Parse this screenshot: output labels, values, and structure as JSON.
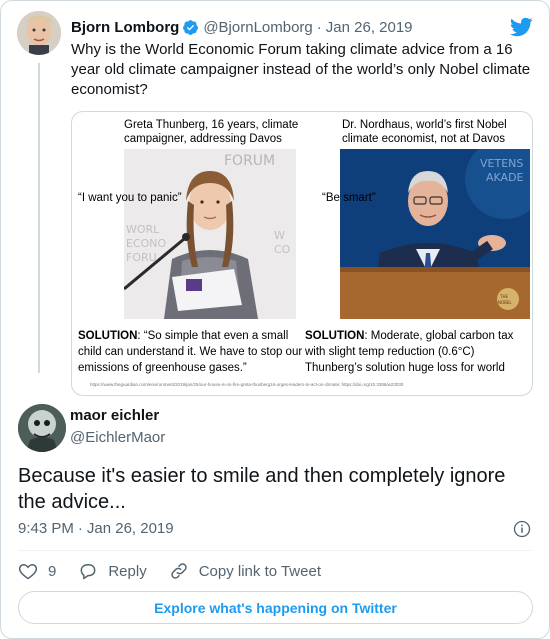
{
  "parent_tweet": {
    "name": "Bjorn Lomborg",
    "handle": "@BjornLomborg",
    "separator": "·",
    "date": "Jan 26, 2019",
    "text": "Why is the World Economic Forum taking climate advice from a 16 year old climate campaigner instead of the world’s only Nobel climate economist?"
  },
  "image": {
    "left_caption": "Greta Thunberg, 16 years, climate campaigner, addressing Davos",
    "right_caption": "Dr. Nordhaus, world’s first Nobel climate economist, not at Davos",
    "left_quote": "“I want you to panic”",
    "right_quote": "“Be smart”",
    "left_solution_label": "SOLUTION",
    "left_solution_text": ": “So simple that even a small child can understand it. We have to stop our emissions of greenhouse gases.”",
    "right_solution_label": "SOLUTION",
    "right_solution_text": ": Moderate, global carbon tax with slight temp reduction (0.6°C) Thunberg’s solution huge loss for world",
    "left_backdrop_text": "FORUM",
    "left_backdrop_text2": "WORLD ECONOMIC FORUM",
    "right_backdrop_text": "VETENSKAPS AKADEMIEN",
    "nobel_badge": "THE NOBEL PRIZE",
    "source_urls": "https://www.theguardian.com/environment/2019/jan/25/our-house-is-on-fire-greta-thunberg16-urges-leaders-to-act-on-climate; https://doi.org/10.3386/w23030"
  },
  "reply_tweet": {
    "name": "maor eichler",
    "handle": "@EichlerMaor",
    "text": "Because it's easier to smile and then completely ignore the advice...",
    "time": "9:43 PM",
    "separator": "·",
    "date": "Jan 26, 2019"
  },
  "actions": {
    "like_count": "9",
    "reply_label": "Reply",
    "copy_link_label": "Copy link to Tweet"
  },
  "explore_label": "Explore what's happening on Twitter",
  "colors": {
    "twitter_blue": "#1d9bf0",
    "secondary_text": "#536471",
    "border": "#cfd9de"
  }
}
